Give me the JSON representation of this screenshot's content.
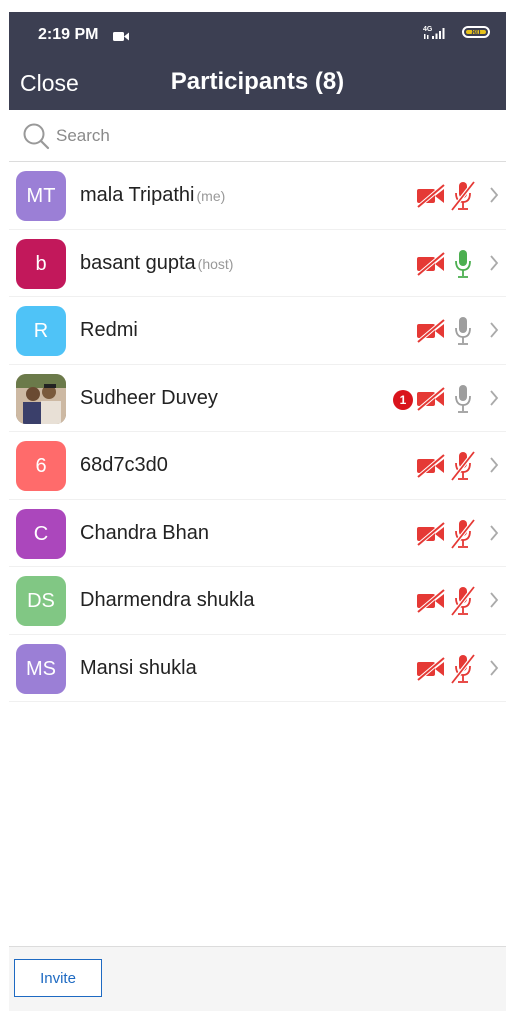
{
  "status_bar": {
    "time": "2:19 PM",
    "network": "4G",
    "battery": "80"
  },
  "header": {
    "close_label": "Close",
    "title": "Participants (8)"
  },
  "search": {
    "placeholder": "Search",
    "value": ""
  },
  "participants": [
    {
      "initials": "MT",
      "name": "mala Tripathi",
      "role": "(me)",
      "avatar_color": "#9b7fd6",
      "video": "off",
      "audio": "muted",
      "badge": ""
    },
    {
      "initials": "b",
      "name": "basant gupta",
      "role": "(host)",
      "avatar_color": "#c2185b",
      "video": "off",
      "audio": "active",
      "badge": ""
    },
    {
      "initials": "R",
      "name": "Redmi",
      "role": "",
      "avatar_color": "#4fc3f7",
      "video": "off",
      "audio": "on",
      "badge": ""
    },
    {
      "initials": "",
      "name": "Sudheer Duvey",
      "role": "",
      "avatar_color": "#8a6a52",
      "video": "off",
      "audio": "on",
      "badge": "1"
    },
    {
      "initials": "6",
      "name": "68d7c3d0",
      "role": "",
      "avatar_color": "#ff6b6b",
      "video": "off",
      "audio": "muted",
      "badge": ""
    },
    {
      "initials": "C",
      "name": "Chandra Bhan",
      "role": "",
      "avatar_color": "#ab47bc",
      "video": "off",
      "audio": "muted",
      "badge": ""
    },
    {
      "initials": "DS",
      "name": "Dharmendra shukla",
      "role": "",
      "avatar_color": "#81c784",
      "video": "off",
      "audio": "muted",
      "badge": ""
    },
    {
      "initials": "MS",
      "name": "Mansi shukla",
      "role": "",
      "avatar_color": "#9b7fd6",
      "video": "off",
      "audio": "muted",
      "badge": ""
    }
  ],
  "footer": {
    "invite_label": "Invite"
  },
  "colors": {
    "header_bg": "#3c3f52",
    "muted_red": "#e53935",
    "active_green": "#4caf50",
    "mic_gray": "#9e9e9e",
    "accent_blue": "#1e6ac2"
  }
}
